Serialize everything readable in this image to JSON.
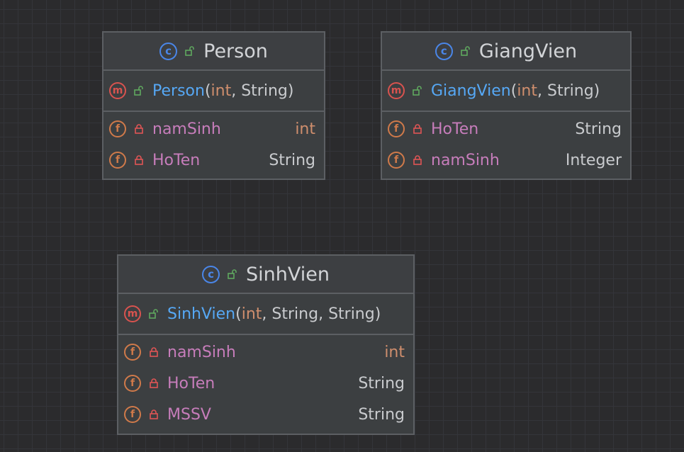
{
  "colors": {
    "background": "#2b2b2d",
    "box_fill": "#3c3f41",
    "box_border": "#5c5f63",
    "class_icon": "#4a86e8",
    "method_icon": "#d9534f",
    "field_icon": "#d07a4a",
    "method_name": "#56a8f5",
    "field_name": "#c77dbb",
    "primitive_type": "#cf8e6d",
    "text": "#c9cbce"
  },
  "icons": {
    "class": "c",
    "method": "m",
    "field": "f"
  },
  "classes": {
    "person": {
      "name": "Person",
      "constructor": {
        "name": "Person",
        "open": "(",
        "params": [
          {
            "type": "int"
          },
          {
            "type": "String"
          }
        ],
        "close": ")"
      },
      "fields": [
        {
          "name": "namSinh",
          "type": "int"
        },
        {
          "name": "HoTen",
          "type": "String"
        }
      ]
    },
    "giangvien": {
      "name": "GiangVien",
      "constructor": {
        "name": "GiangVien",
        "open": "(",
        "params": [
          {
            "type": "int"
          },
          {
            "type": "String"
          }
        ],
        "close": ")"
      },
      "fields": [
        {
          "name": "HoTen",
          "type": "String"
        },
        {
          "name": "namSinh",
          "type": "Integer"
        }
      ]
    },
    "sinhvien": {
      "name": "SinhVien",
      "constructor": {
        "name": "SinhVien",
        "open": "(",
        "params": [
          {
            "type": "int"
          },
          {
            "type": "String"
          },
          {
            "type": "String"
          }
        ],
        "close": ")"
      },
      "fields": [
        {
          "name": "namSinh",
          "type": "int"
        },
        {
          "name": "HoTen",
          "type": "String"
        },
        {
          "name": "MSSV",
          "type": "String"
        }
      ]
    }
  }
}
